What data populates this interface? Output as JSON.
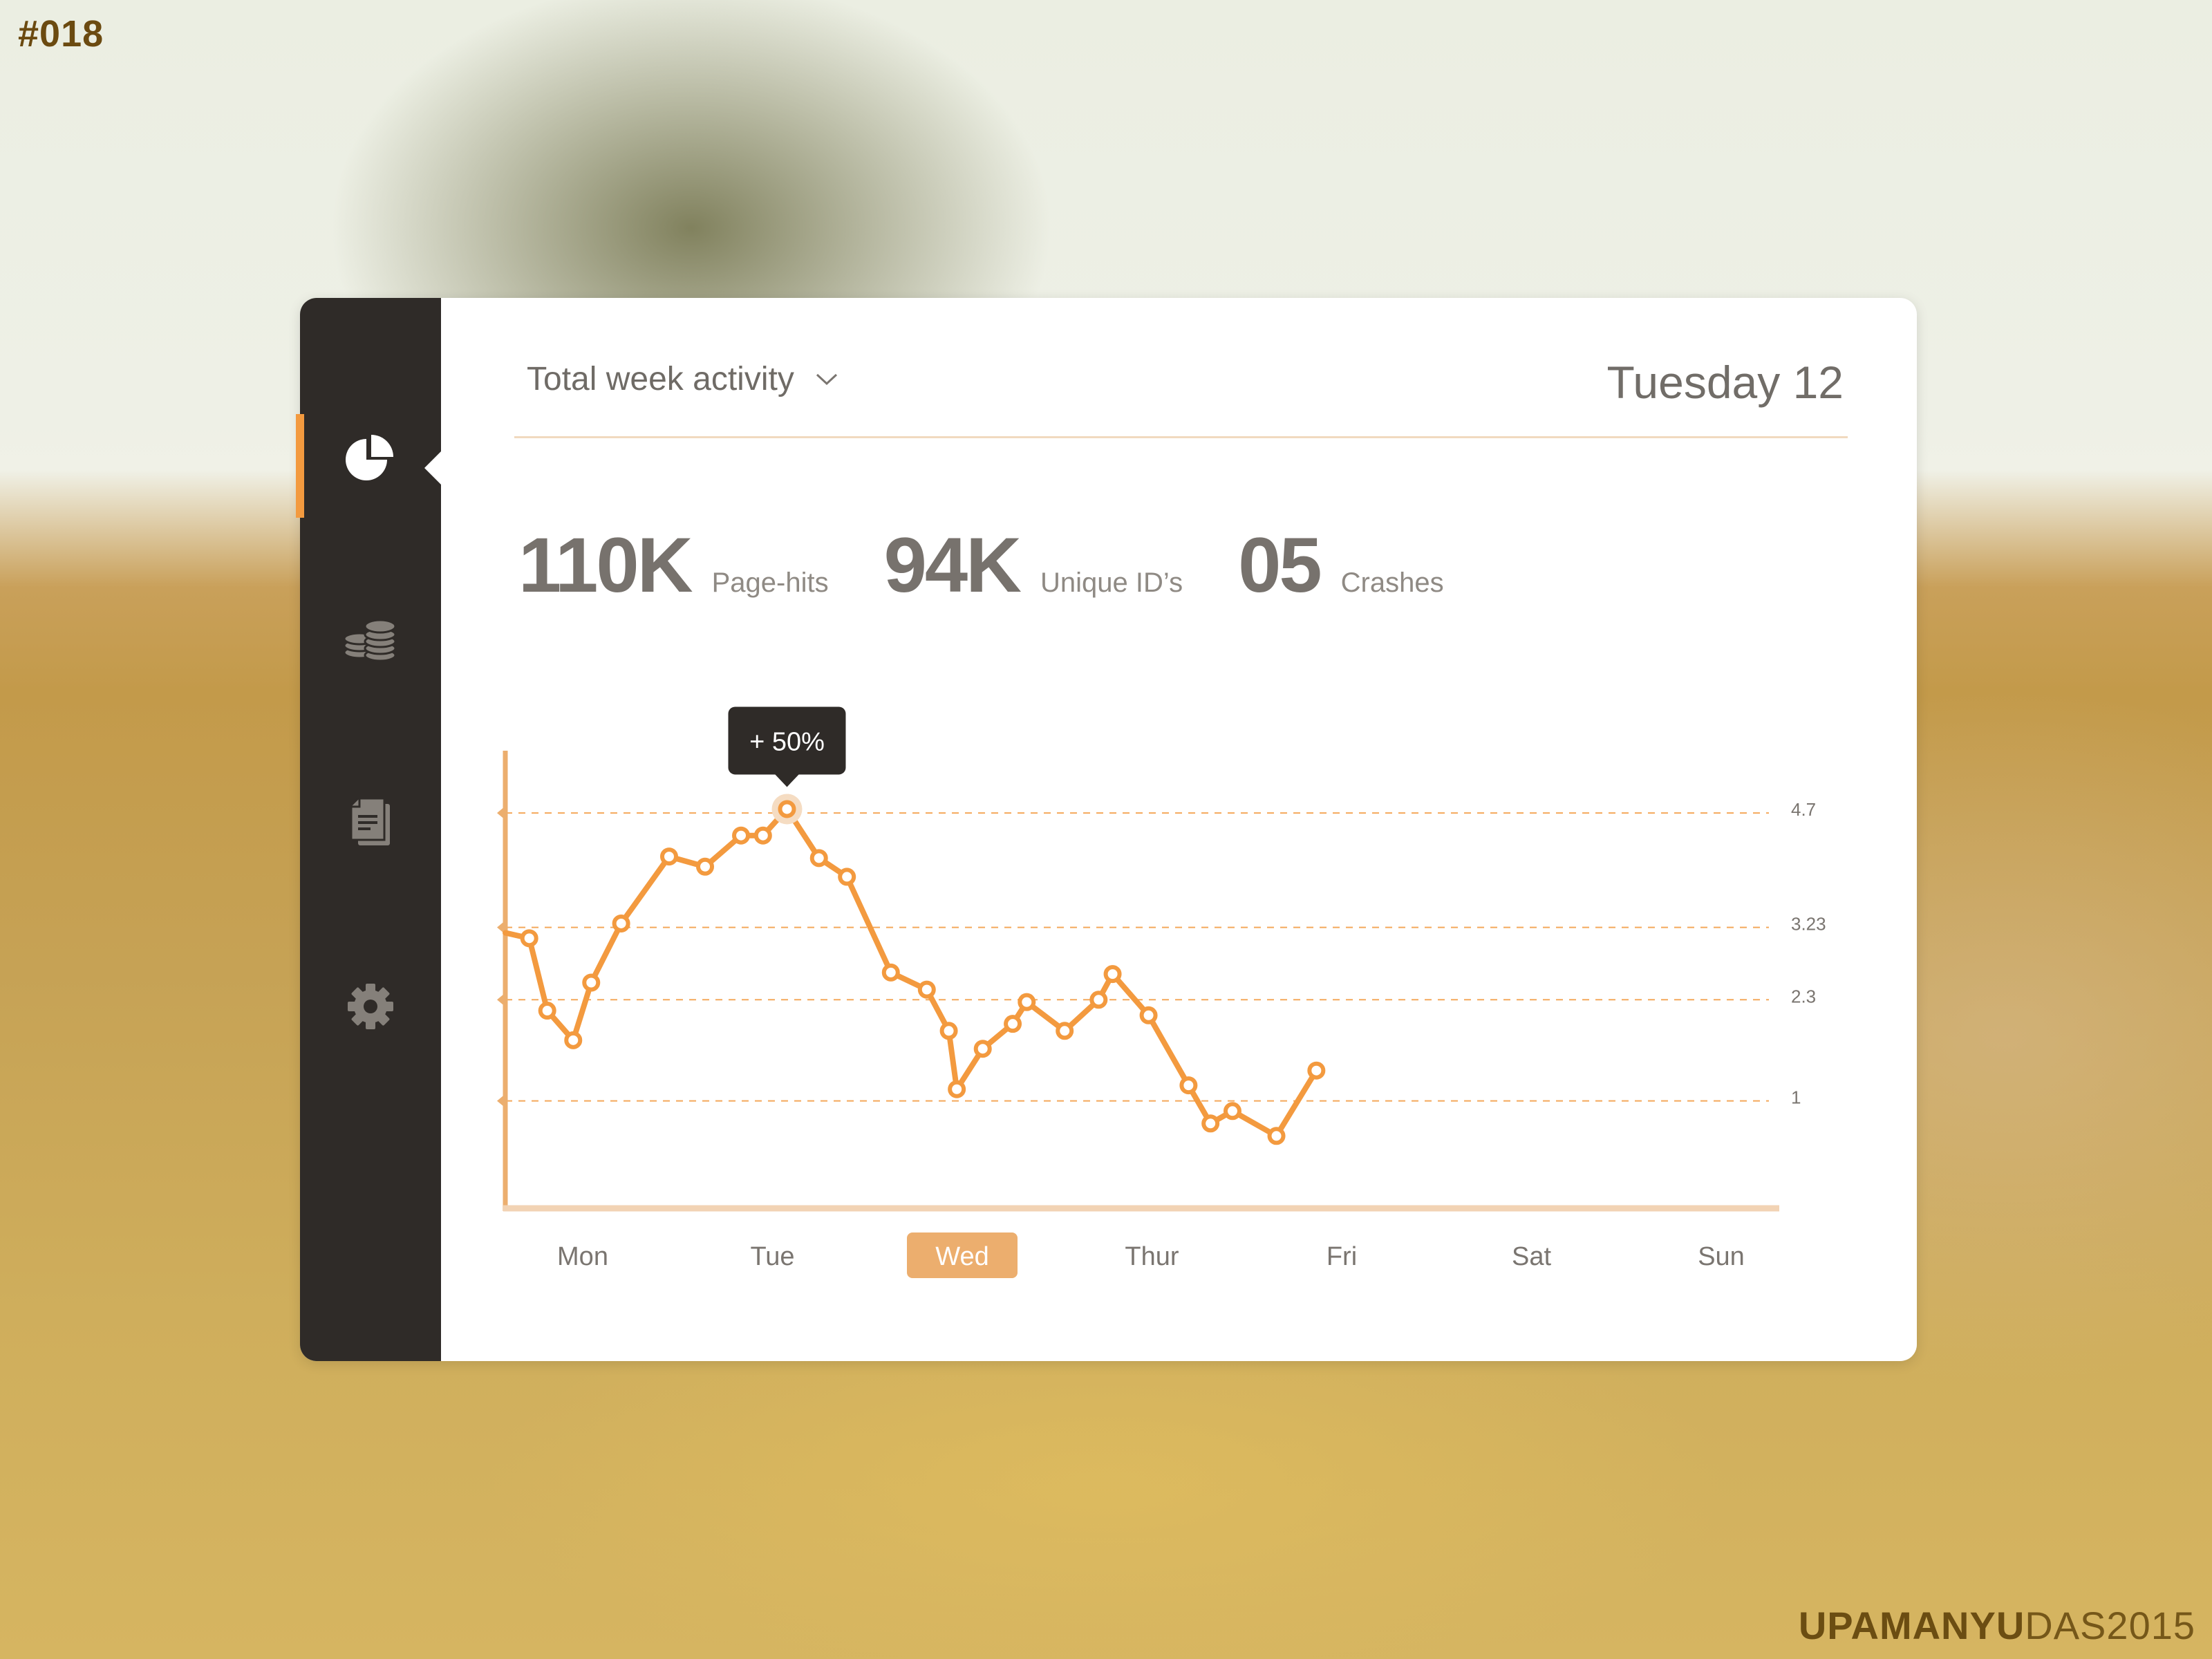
{
  "corner_id": "#018",
  "watermark": {
    "bold": "UPAMANYU",
    "light": "DAS",
    "year": "2015"
  },
  "sidebar": {
    "active_index": 0,
    "items": [
      {
        "icon": "pie-chart-icon",
        "label": "Analytics"
      },
      {
        "icon": "coins-icon",
        "label": "Revenue"
      },
      {
        "icon": "documents-icon",
        "label": "Reports"
      },
      {
        "icon": "gear-icon",
        "label": "Settings"
      }
    ]
  },
  "header": {
    "title": "Total week activity",
    "date": "Tuesday 12"
  },
  "stats": [
    {
      "value": "110K",
      "label": "Page-hits"
    },
    {
      "value": "94K",
      "label": "Unique ID’s"
    },
    {
      "value": "05",
      "label": "Crashes"
    }
  ],
  "colors": {
    "accent": "#f39a3f",
    "accent_soft": "#ecae6e",
    "sidebar_bg": "#2f2b28",
    "text": "#77726d",
    "tooltip_bg": "#2f2b28"
  },
  "chart_data": {
    "type": "line",
    "title": "Total week activity",
    "xlabel": "",
    "ylabel": "",
    "categories": [
      "Mon",
      "Tue",
      "Wed",
      "Thur",
      "Fri",
      "Sat",
      "Sun"
    ],
    "selected_category": "Wed",
    "yticks": [
      1,
      2.3,
      3.23,
      4.7
    ],
    "ytick_labels": [
      "1",
      "2.3",
      "3.23",
      "4.7"
    ],
    "ylim": [
      -0.38,
      5.5
    ],
    "grid": "dashed horizontal at ticks",
    "legend": "none",
    "series": [
      {
        "name": "activity",
        "x": [
          0.0,
          0.12,
          0.21,
          0.34,
          0.43,
          0.58,
          0.82,
          1.0,
          1.18,
          1.29,
          1.41,
          1.57,
          1.71,
          1.93,
          2.11,
          2.22,
          2.26,
          2.39,
          2.54,
          2.61,
          2.8,
          2.97,
          3.04,
          3.22,
          3.42,
          3.53,
          3.64,
          3.86,
          4.06
        ],
        "values": [
          3.16,
          3.09,
          2.16,
          1.78,
          2.52,
          3.28,
          4.14,
          4.01,
          4.41,
          4.41,
          4.75,
          4.12,
          3.88,
          2.65,
          2.43,
          1.9,
          1.15,
          1.67,
          1.99,
          2.27,
          1.9,
          2.3,
          2.63,
          2.1,
          1.2,
          0.71,
          0.87,
          0.55,
          1.39
        ],
        "marker_from_index": 1,
        "highlight_index": 10
      }
    ],
    "annotations": [
      {
        "point_index": 10,
        "text": "+ 50%"
      }
    ]
  }
}
